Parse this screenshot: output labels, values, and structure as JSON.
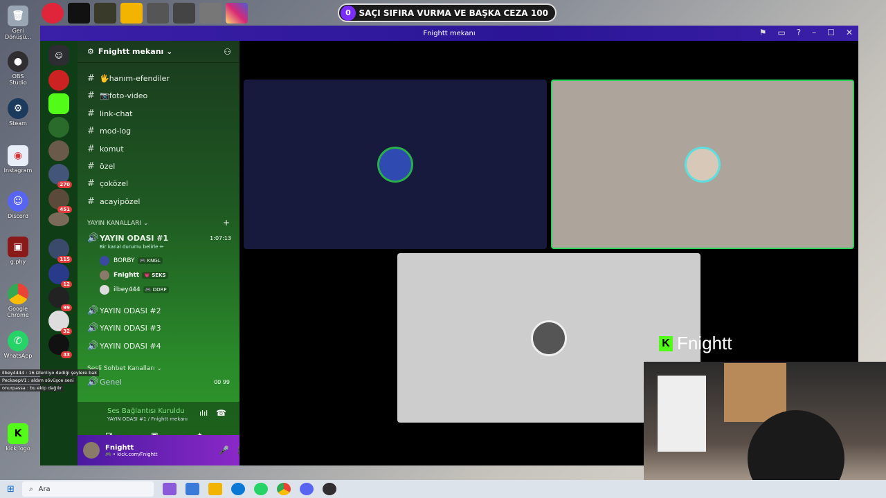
{
  "desktop": {
    "icons": [
      {
        "label": "Geri Dönüşü...",
        "icon": "recycle-bin-icon",
        "color": "#9aa6b4"
      },
      {
        "label": "OBS Studio",
        "icon": "obs-icon",
        "color": "#302e31"
      },
      {
        "label": "Steam",
        "icon": "steam-icon",
        "color": "#1b3a5c"
      },
      {
        "label": "Instagram",
        "icon": "chrome-icon",
        "color": "#e7eef7"
      },
      {
        "label": "Discord",
        "icon": "discord-icon",
        "color": "#5865f2"
      },
      {
        "label": "g.phy",
        "icon": "image-icon",
        "color": "#8a1a1a"
      },
      {
        "label": "Google Chrome",
        "icon": "chrome-icon",
        "color": "#e7eef7"
      },
      {
        "label": "WhatsApp",
        "icon": "whatsapp-icon",
        "color": "#25d366"
      },
      {
        "label": "kick logo",
        "icon": "kick-icon",
        "color": "#53fc18"
      }
    ]
  },
  "alert": {
    "badge": "0",
    "text": "SAÇI SIFIRA VURMA VE BAŞKA CEZA",
    "value": "100"
  },
  "window": {
    "title": "Fnightt mekanı"
  },
  "server": {
    "name": "Fnightt mekanı ⌄",
    "text_channels": [
      "🖐hanım-efendiler",
      "📷foto-video",
      "link-chat",
      "mod-log",
      "komut",
      "özel",
      "çoközel",
      "acayipözel"
    ],
    "category_stream": "YAYIN KANALLARI ⌄",
    "voice_active": {
      "name": "YAYIN ODASI #1",
      "time": "1:07:13",
      "status": "Bir kanal durumu belirle ✏"
    },
    "voice_users": [
      {
        "name": "BORBY",
        "tag": "🎮 KNGL"
      },
      {
        "name": "Fnightt",
        "tag": "💗 SEKS"
      },
      {
        "name": "ilbey444",
        "tag": "🎮 DDRP"
      }
    ],
    "voice_channels": [
      "YAYIN ODASI #2",
      "YAYIN ODASI #3",
      "YAYIN ODASI #4"
    ],
    "category_voice": "Sesli Sohbet Kanalları ⌄",
    "general": "Genel",
    "general_counts": "00   99"
  },
  "connection": {
    "status": "Ses Bağlantısı Kuruldu",
    "channel": "YAYIN ODASI #1 / Fnightt mekanı"
  },
  "user": {
    "name": "Fnightt",
    "sub": "🎮 • kick.com/Fnightt"
  },
  "chat_overlay": [
    "ilbey4444 : 16 izlenliyo dediği şeylere bak",
    "PeckaepV1 : aldım sövüşce seni",
    "onurpassa : bu ekip dağılır"
  ],
  "guild_badges": [
    "270",
    "451",
    "115",
    "12",
    "99",
    "32",
    "33"
  ],
  "kick_overlay": "Fnightt",
  "taskbar": {
    "search": "Ara"
  },
  "colors": {
    "accent": "#53fc18",
    "discord_title": "#2b1696",
    "tile_blue": "#171a3d",
    "tile_tan": "#ada59c",
    "tile_grey": "#cdcdcd"
  }
}
